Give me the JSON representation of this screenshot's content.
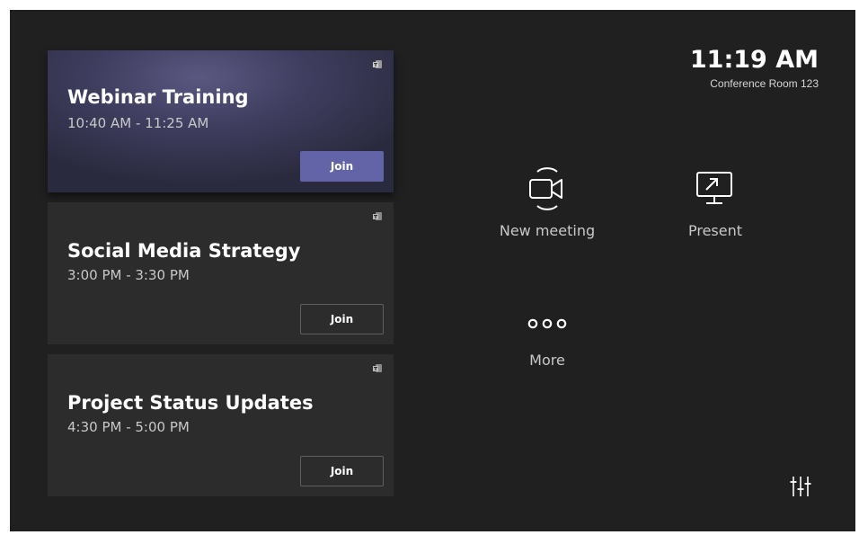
{
  "meetings": [
    {
      "title": "Webinar Training",
      "time": "10:40 AM - 11:25 AM",
      "join_label": "Join",
      "icon": "teams-icon",
      "active": true
    },
    {
      "title": "Social Media Strategy",
      "time": "3:00 PM - 3:30 PM",
      "join_label": "Join",
      "icon": "teams-icon",
      "active": false
    },
    {
      "title": "Project Status Updates",
      "time": "4:30 PM - 5:00 PM",
      "join_label": "Join",
      "icon": "teams-icon",
      "active": false
    }
  ],
  "header": {
    "time": "11:19 AM",
    "room": "Conference Room 123"
  },
  "actions": {
    "new_meeting": {
      "label": "New meeting",
      "icon": "video-camera-icon"
    },
    "present": {
      "label": "Present",
      "icon": "screen-share-icon"
    },
    "more": {
      "label": "More",
      "icon": "more-icon"
    }
  },
  "settings": {
    "icon": "settings-sliders-icon"
  },
  "colors": {
    "background": "#202020",
    "card": "#2c2c2c",
    "accent": "#6264a7"
  }
}
